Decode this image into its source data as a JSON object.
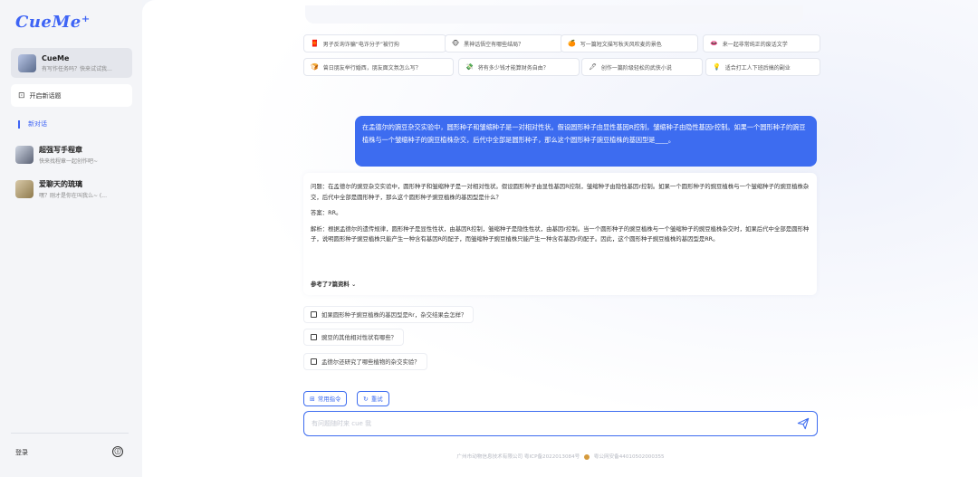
{
  "sidebar": {
    "logo": "CueMe⁺",
    "bot": {
      "name": "CueMe",
      "subtitle": "有写作任务吗？快来试试我..."
    },
    "new_chat_label": "开启新话题",
    "section_label": "新对话",
    "conversations": [
      {
        "title": "超强写手程章",
        "subtitle": "快来找程章一起创作吧~"
      },
      {
        "title": "爱聊天的琉璃",
        "subtitle": "嘿？刚才是你在叫我么~ (..."
      }
    ],
    "login_label": "登录",
    "info_icon": "ⓘ"
  },
  "prompts": [
    {
      "icon": "🧧",
      "text": "男子反询诈骗“电诈分子”被行拘"
    },
    {
      "icon": "🐵",
      "text": "黑神话悟空有哪些结局？"
    },
    {
      "icon": "🍊",
      "text": "写一篇短文描写秋天风吹麦的景色"
    },
    {
      "icon": "👄",
      "text": "来一起非常纯正的废话文学"
    },
    {
      "icon": "🍞",
      "text": "曾日朋友举行婚西，朋友面文氛怎么写？"
    },
    {
      "icon": "💸",
      "text": "将有多少钱才能算财务自由？"
    },
    {
      "icon": "🖋",
      "text": "创作一篇阶级轻松的武侠小说"
    },
    {
      "icon": "💡",
      "text": "适合打工人下班后搞的副业"
    }
  ],
  "chat": {
    "user_message": "在孟德尔的豌豆杂交实验中，圆形种子和皱缩种子是一对相对性状。假设圆形种子由显性基因R控制，皱缩种子由隐性基因r控制。如果一个圆形种子的豌豆植株与一个皱缩种子的豌豆植株杂交，后代中全部是圆形种子，那么这个圆形种子豌豆植株的基因型是____。",
    "answer": {
      "question": "问题：在孟德尔的豌豆杂交实验中，圆形种子和皱缩种子是一对相对性状。假设圆形种子由显性基因R控制，皱缩种子由隐性基因r控制。如果一个圆形种子的豌豆植株与一个皱缩种子的豌豆植株杂交，后代中全部是圆形种子，那么这个圆形种子豌豆植株的基因型是什么？",
      "answer_line": "答案：RR。",
      "analysis": "解析：根据孟德尔的遗传规律，圆形种子是显性性状，由基因R控制，皱缩种子是隐性性状，由基因r控制。当一个圆形种子的豌豆植株与一个皱缩种子的豌豆植株杂交时，如果后代中全部是圆形种子，说明圆形种子豌豆植株只能产生一种含有基因R的配子，而皱缩种子豌豆植株只能产生一种含有基因r的配子。因此，这个圆形种子豌豆植株的基因型是RR。",
      "references": "参考了7篇资料 ⌄"
    },
    "suggestions": [
      "如果圆形种子豌豆植株的基因型是Rr，杂交结果会怎样？",
      "豌豆的其他相对性状有哪些？",
      "孟德尔还研究了哪些植物的杂交实验？"
    ]
  },
  "composer": {
    "common_cmd": "常用指令",
    "retry": "重试",
    "placeholder": "有问题随时来 cue 我"
  },
  "footer": {
    "icp": "广州市动物信息技术有限公司 粤ICP备2022013084号",
    "police": "粤公网安备44010502000355"
  },
  "colors": {
    "accent": "#3d6cf0",
    "sidebar_bg": "#f4f5f8"
  }
}
